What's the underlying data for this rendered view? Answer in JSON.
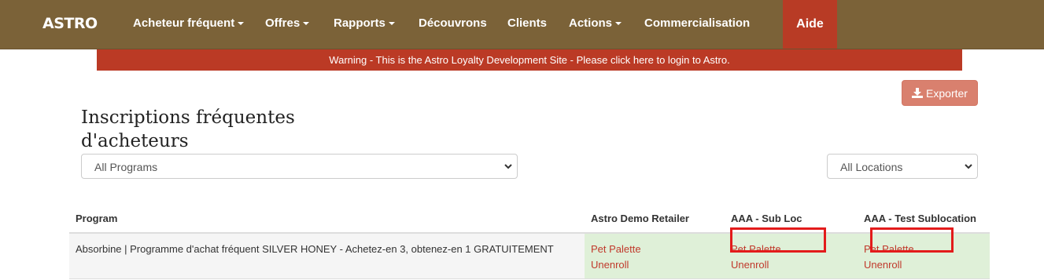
{
  "navbar": {
    "brand": "ASTRO",
    "items": [
      {
        "label": "Acheteur fréquent",
        "caret": true
      },
      {
        "label": "Offres",
        "caret": true
      },
      {
        "label": "Rapports",
        "caret": true
      },
      {
        "label": "Découvrons",
        "caret": false
      },
      {
        "label": "Clients",
        "caret": false
      },
      {
        "label": "Actions",
        "caret": true
      },
      {
        "label": "Commercialisation",
        "caret": false
      }
    ],
    "help_label": "Aide"
  },
  "warning": {
    "text": "Warning - This is the Astro Loyalty Development Site - Please click here to login to Astro."
  },
  "export": {
    "label": "Exporter",
    "icon": "download-icon"
  },
  "page": {
    "title": "Inscriptions fréquentes d'acheteurs"
  },
  "filters": {
    "program": {
      "selected": "All Programs"
    },
    "location": {
      "selected": "All Locations"
    }
  },
  "table": {
    "headers": {
      "program": "Program",
      "store1": "Astro Demo Retailer",
      "store2": "AAA - Sub Loc",
      "store3": "AAA - Test Sublocation"
    },
    "rows": [
      {
        "program": "Absorbine | Programme d'achat fréquent SILVER HONEY - Achetez-en 3, obtenez-en 1 GRATUITEMENT",
        "store1": {
          "top": "Pet Palette",
          "bottom": "Unenroll"
        },
        "store2": {
          "top": "Pet Palette",
          "bottom": "Unenroll"
        },
        "store3": {
          "top": "Pet Palette",
          "bottom": "Unenroll"
        }
      }
    ]
  },
  "colors": {
    "navbar": "#7b6238",
    "help_bg": "#b83b25",
    "warning_bg": "#bb3a25",
    "export_bg": "#d9806e",
    "link": "#c0392b",
    "enrolled_cell": "#dff0d8",
    "highlight_box": "#e31b1b"
  }
}
